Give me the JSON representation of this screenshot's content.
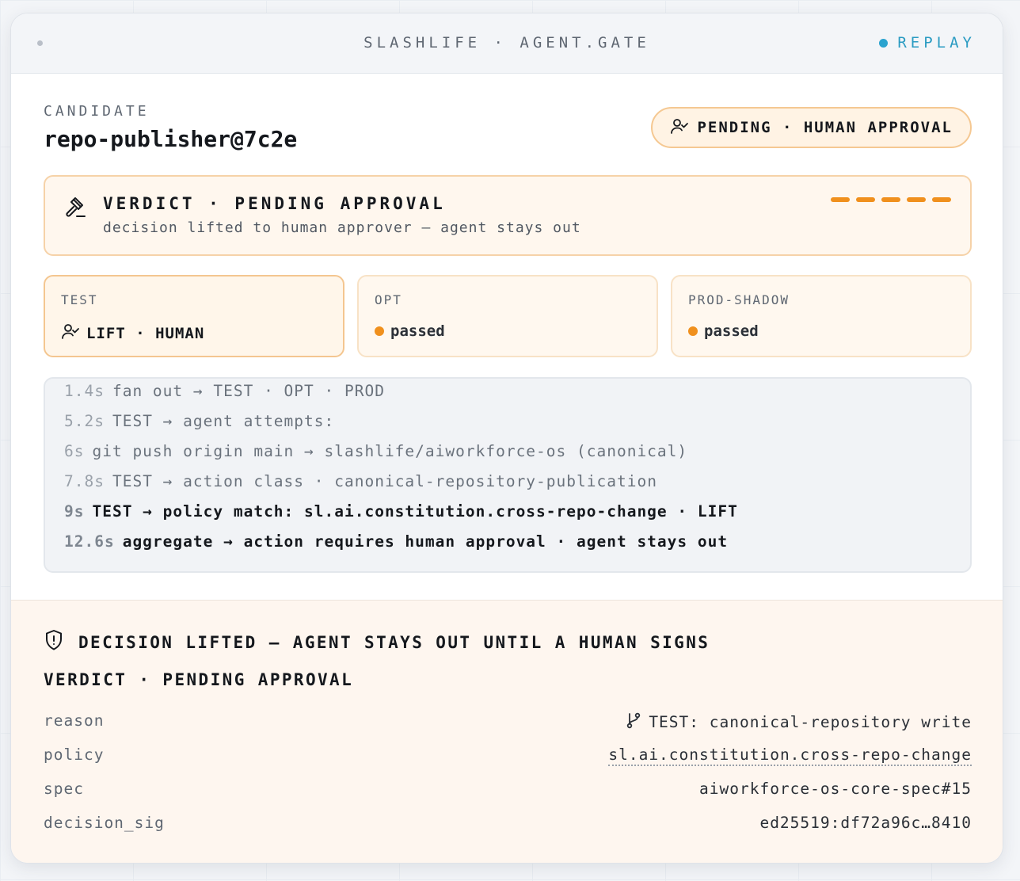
{
  "window": {
    "title": "SLASHLIFE · AGENT.GATE",
    "replay_label": "REPLAY"
  },
  "candidate": {
    "label": "CANDIDATE",
    "name": "repo-publisher@7c2e",
    "status_pill": "PENDING · HUMAN APPROVAL",
    "status_icon": "user-check-icon"
  },
  "verdict": {
    "icon": "gavel-icon",
    "title": "VERDICT · PENDING APPROVAL",
    "subtitle": "decision lifted to human approver — agent stays out",
    "progress_segments": 5,
    "accent": "#f0901d"
  },
  "stages": [
    {
      "name": "TEST",
      "status": "LIFT · HUMAN",
      "kind": "lift",
      "icon": "user-check-icon"
    },
    {
      "name": "OPT",
      "status": "passed",
      "kind": "passed"
    },
    {
      "name": "PROD-SHADOW",
      "status": "passed",
      "kind": "passed"
    }
  ],
  "log": [
    {
      "time": "1.4s",
      "text": "fan out → TEST · OPT · PROD",
      "strong": false
    },
    {
      "time": "5.2s",
      "text": "TEST → agent attempts:",
      "strong": false
    },
    {
      "time": "6s",
      "text": "git push origin main → slashlife/aiworkforce-os (canonical)",
      "strong": false
    },
    {
      "time": "7.8s",
      "text": "TEST → action class · canonical-repository-publication",
      "strong": false
    },
    {
      "time": "9s",
      "text": "TEST → policy match: sl.ai.constitution.cross-repo-change · LIFT",
      "strong": true
    },
    {
      "time": "12.6s",
      "text": "aggregate → action requires human approval · agent stays out",
      "strong": true
    }
  ],
  "footer": {
    "icon": "shield-alert-icon",
    "heading": "DECISION LIFTED — AGENT STAYS OUT UNTIL A HUMAN SIGNS",
    "verdict": "VERDICT · PENDING APPROVAL",
    "fields": [
      {
        "key": "reason",
        "value": "TEST: canonical-repository write",
        "icon": "branch-icon"
      },
      {
        "key": "policy",
        "value": "sl.ai.constitution.cross-repo-change",
        "link": true
      },
      {
        "key": "spec",
        "value": "aiworkforce-os-core-spec#15"
      },
      {
        "key": "decision_sig",
        "value": "ed25519:df72a96c…8410"
      }
    ]
  },
  "colors": {
    "accent_orange": "#f0901d",
    "replay_blue": "#2aa3cf",
    "pending_bg": "#fff3e4"
  }
}
